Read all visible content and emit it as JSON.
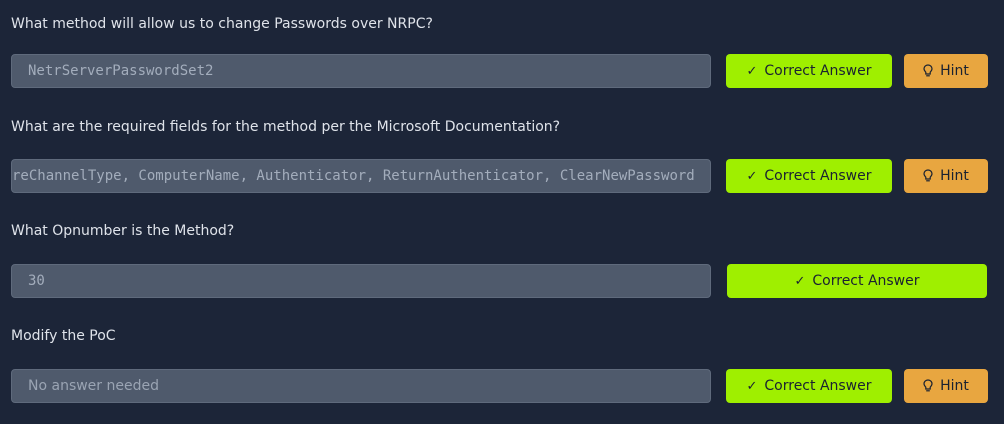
{
  "questions": [
    {
      "text": "What method will allow us to change Passwords over NRPC?",
      "answer": "NetrServerPasswordSet2",
      "correct_label": "Correct Answer",
      "hint_label": "Hint"
    },
    {
      "text": "What are the required fields for the method per the Microsoft Documentation?",
      "answer": "reChannelType, ComputerName, Authenticator, ReturnAuthenticator, ClearNewPassword",
      "correct_label": "Correct Answer",
      "hint_label": "Hint"
    },
    {
      "text": "What Opnumber is the Method?",
      "answer": "30",
      "correct_label": "Correct Answer"
    },
    {
      "text": "Modify the PoC",
      "placeholder": "No answer needed",
      "correct_label": "Correct Answer",
      "hint_label": "Hint"
    }
  ],
  "icons": {
    "correct": "check-icon",
    "hint": "lightbulb-icon"
  },
  "colors": {
    "background": "#1c2538",
    "input_background": "#4f5a6c",
    "correct_button": "#9fef00",
    "hint_button": "#ffb441"
  }
}
